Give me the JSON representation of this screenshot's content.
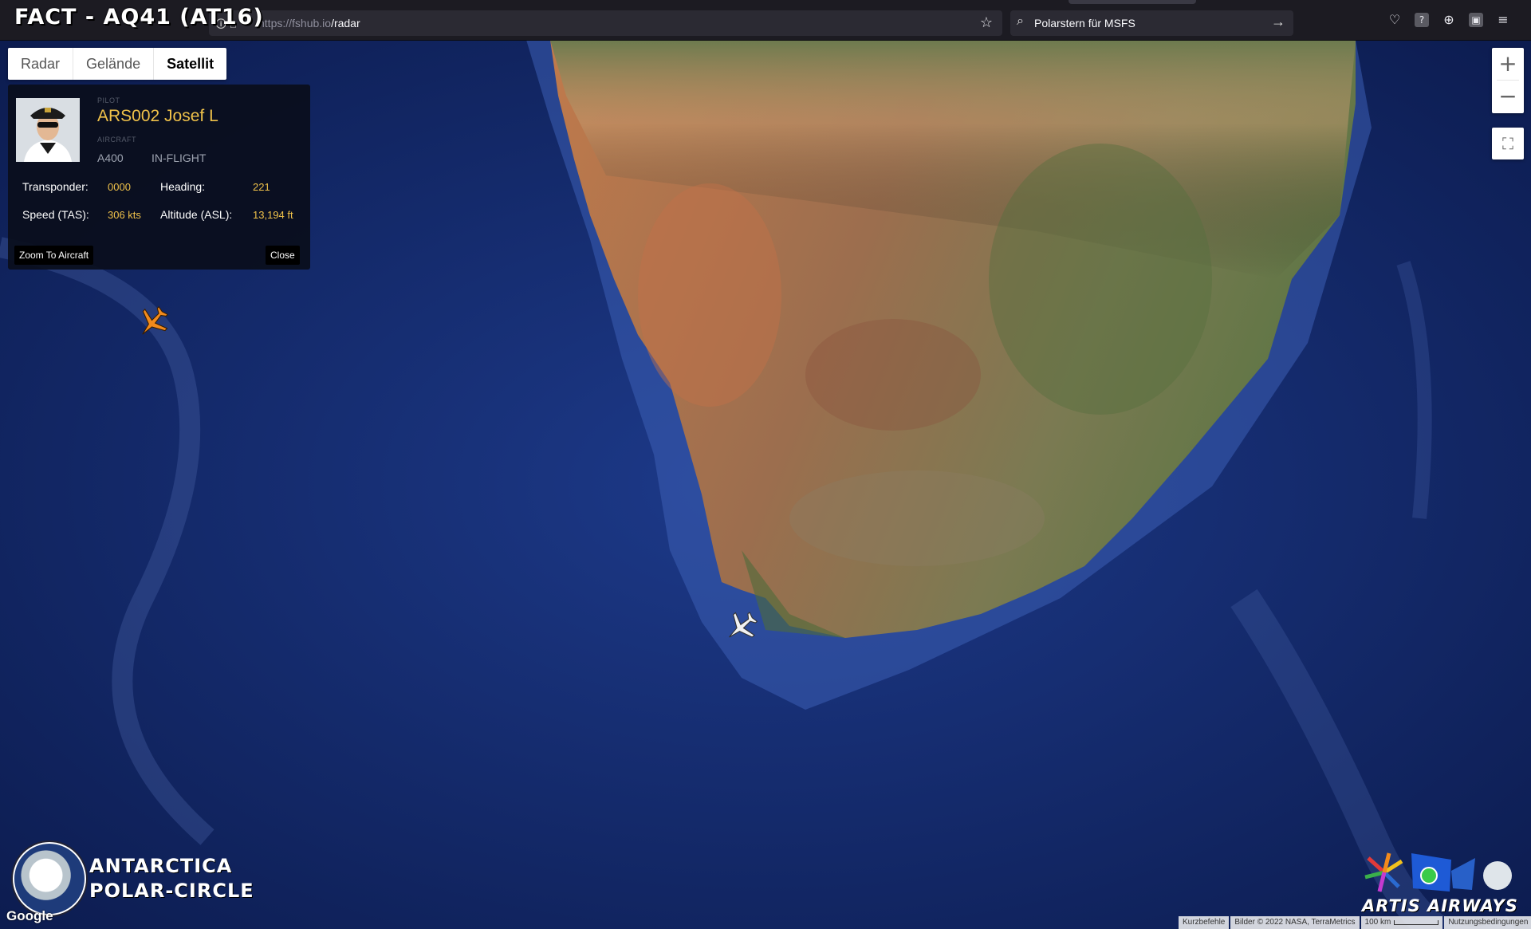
{
  "overlay_title": "FACT - AQ41 (AT16)",
  "browser": {
    "url_host": "https://fshub.io",
    "url_path": "/radar",
    "search_query": "Polarstern für MSFS"
  },
  "map_types": [
    "Radar",
    "Gelände",
    "Satellit"
  ],
  "map_type_active": "Satellit",
  "zoom": {
    "in": "+",
    "out": "−"
  },
  "pilot_panel": {
    "pilot_label": "PILOT",
    "pilot_name": "ARS002 Josef L",
    "aircraft_label": "AIRCRAFT",
    "aircraft": "A400",
    "status": "IN-FLIGHT",
    "transponder_label": "Transponder:",
    "transponder": "0000",
    "heading_label": "Heading:",
    "heading": "221",
    "speed_label": "Speed (TAS):",
    "speed": "306 kts",
    "altitude_label": "Altitude (ASL):",
    "altitude": "13,194 ft",
    "zoom_button": "Zoom To Aircraft",
    "close_button": "Close"
  },
  "logos": {
    "left_line1": "ANTARCTICA",
    "left_line2": "POLAR-CIRCLE",
    "right_text": "ARTIS AIRWAYS",
    "google": "Google"
  },
  "attribution": {
    "shortcuts": "Kurzbefehle",
    "imagery": "Bilder © 2022 NASA, TerraMetrics",
    "scale": "100 km",
    "terms": "Nutzungsbedingungen"
  },
  "colors": {
    "ocean_deep": "#0c1c52",
    "ocean_shelf": "#3a5ab0",
    "land_desert": "#b0704a",
    "land_green": "#6e7a4a",
    "accent_yellow": "#f0c24a",
    "selected_aircraft": "#f28a1c"
  }
}
